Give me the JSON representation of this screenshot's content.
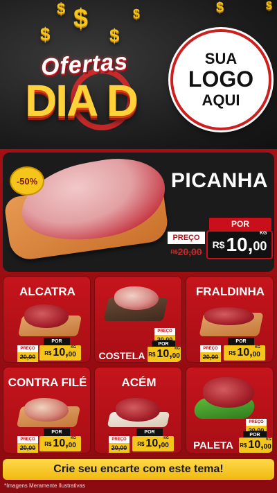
{
  "hero": {
    "logo_line1": "Ofertas",
    "logo_line2": "DIA D",
    "logo_placeholder": [
      "SUA",
      "LOGO",
      "AQUI"
    ],
    "dollar_symbol": "$"
  },
  "featured": {
    "name": "PICANHA",
    "discount": "-50%",
    "old_label": "PREÇO",
    "old_currency": "R$",
    "old_price": "20,00",
    "new_label": "POR",
    "new_currency": "R$",
    "new_price_int": "10,",
    "new_price_cents": "00",
    "unit": "KG"
  },
  "cards": [
    {
      "name": "ALCATRA",
      "old_label": "PREÇO",
      "old_price": "20,00",
      "new_label": "POR",
      "currency": "R$",
      "price_int": "10,",
      "price_cents": "00",
      "unit": "KG"
    },
    {
      "name": "COSTELA",
      "old_label": "PREÇO",
      "old_price": "20,00",
      "new_label": "POR",
      "currency": "R$",
      "price_int": "10,",
      "price_cents": "00",
      "unit": "KG"
    },
    {
      "name": "FRALDINHA",
      "old_label": "PREÇO",
      "old_price": "20,00",
      "new_label": "POR",
      "currency": "R$",
      "price_int": "10,",
      "price_cents": "00",
      "unit": "KG"
    },
    {
      "name": "CONTRA FILÉ",
      "old_label": "PREÇO",
      "old_price": "20,00",
      "new_label": "POR",
      "currency": "R$",
      "price_int": "10,",
      "price_cents": "00",
      "unit": "KG"
    },
    {
      "name": "ACÉM",
      "old_label": "PREÇO",
      "old_price": "20,00",
      "new_label": "POR",
      "currency": "R$",
      "price_int": "10,",
      "price_cents": "00",
      "unit": "KG"
    },
    {
      "name": "PALETA",
      "old_label": "PREÇO",
      "old_price": "20,00",
      "new_label": "POR",
      "currency": "R$",
      "price_int": "10,",
      "price_cents": "00",
      "unit": "KG"
    }
  ],
  "cta": {
    "label": "Crie seu encarte com este tema!"
  },
  "footer": {
    "disclaimer": "*Imagens Meramente Ilustrativas"
  },
  "colors": {
    "brand_red": "#c6141c",
    "accent_yellow": "#f6c51b",
    "dark": "#1b1b1b"
  },
  "icons": [
    "dollar-sign-icon",
    "discount-badge-icon"
  ]
}
